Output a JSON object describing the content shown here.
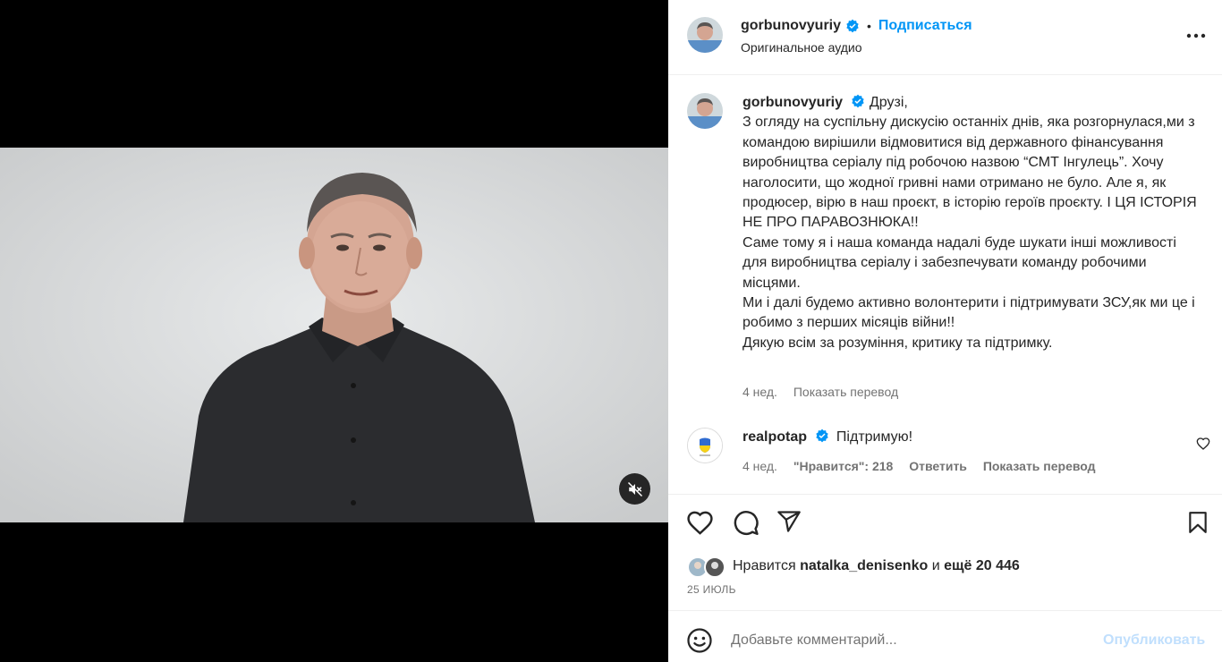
{
  "post": {
    "author": "gorbunovyuriy",
    "separator_dot": "•",
    "follow_label": "Подписаться",
    "audio_label": "Оригинальное аудио",
    "more_icon": "more-horizontal-icon"
  },
  "caption": {
    "username": "gorbunovyuriy",
    "lines": [
      "Друзі,",
      "З огляду на суспільну дискусію останніх днів, яка розгорнулася,ми з командою вирішили відмовитися від державного фінансування виробництва серіалу під робочою назвою “СМТ Інгулець”. Хочу наголосити, що жодної гривні нами отримано не було. Але я, як продюсер, вірю в наш проєкт, в історію героїв проєкту. І ЦЯ ІСТОРІЯ НЕ ПРО ПАРАВОЗНЮКА!!",
      "Саме тому я і наша команда надалі буде шукати інші можливості для виробництва серіалу і забезпечувати команду робочими місцями.",
      "Ми і далі будемо активно волонтерити і підтримувати ЗСУ,як ми це і робимо з перших місяців війни!!",
      "Дякую всім за розуміння, критику та підтримку."
    ],
    "age": "4 нед.",
    "translate_label": "Показать перевод"
  },
  "comment": {
    "username": "realpotap",
    "text": "Підтримую!",
    "age": "4 нед.",
    "likes_label": "\"Нравится\": 218",
    "reply_label": "Ответить",
    "translate_label": "Показать перевод"
  },
  "likes": {
    "prefix": "Нравится",
    "user": "natalka_denisenko",
    "connector": "и",
    "more": "ещё 20 446"
  },
  "date": "25 ИЮЛЬ",
  "comment_box": {
    "placeholder": "Добавьте комментарий...",
    "publish_label": "Опубликовать"
  },
  "colors": {
    "accent": "#0095f6",
    "verified": "#0095f6",
    "muted_text": "#737373",
    "publish_disabled": "#c0dffd"
  }
}
